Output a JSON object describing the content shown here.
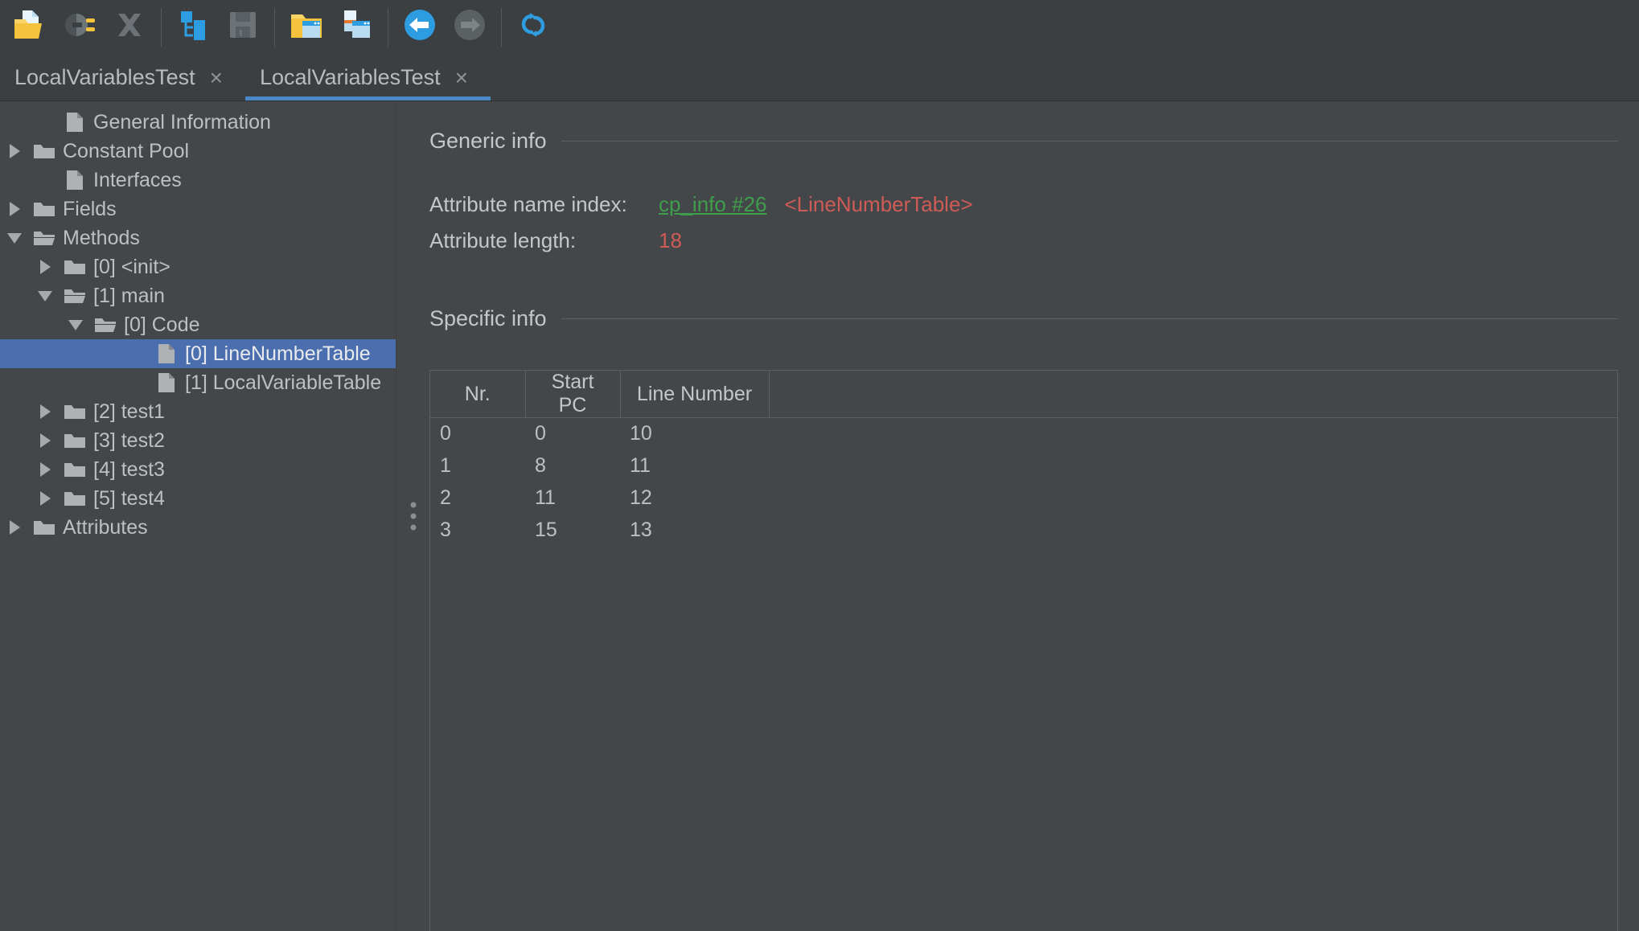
{
  "toolbar": {
    "buttons": [
      {
        "name": "open-class-file-icon",
        "title": "Open class file"
      },
      {
        "name": "browse-classpath-icon",
        "title": "Browse classpath"
      },
      {
        "name": "close-icon",
        "title": "Close"
      },
      {
        "name": "expand-tree-icon",
        "title": "Expand tree"
      },
      {
        "name": "save-icon",
        "title": "Save"
      },
      {
        "name": "open-window-icon",
        "title": "Open window"
      },
      {
        "name": "new-window-icon",
        "title": "New window"
      },
      {
        "name": "back-icon",
        "title": "Back"
      },
      {
        "name": "forward-icon",
        "title": "Forward"
      },
      {
        "name": "reload-icon",
        "title": "Reload"
      }
    ]
  },
  "tabs": [
    {
      "label": "LocalVariablesTest",
      "close": "×",
      "active": false
    },
    {
      "label": "LocalVariablesTest",
      "close": "×",
      "active": true
    }
  ],
  "tree": {
    "items": [
      {
        "label": "General Information",
        "indent": 1,
        "icon": "file",
        "toggle": "none",
        "selected": false
      },
      {
        "label": "Constant Pool",
        "indent": 0,
        "icon": "folder",
        "toggle": "closed",
        "selected": false
      },
      {
        "label": "Interfaces",
        "indent": 1,
        "icon": "file",
        "toggle": "none",
        "selected": false
      },
      {
        "label": "Fields",
        "indent": 0,
        "icon": "folder",
        "toggle": "closed",
        "selected": false
      },
      {
        "label": "Methods",
        "indent": 0,
        "icon": "folder-open",
        "toggle": "open",
        "selected": false
      },
      {
        "label": "[0] <init>",
        "indent": 1,
        "icon": "folder",
        "toggle": "closed",
        "selected": false
      },
      {
        "label": "[1] main",
        "indent": 1,
        "icon": "folder-open",
        "toggle": "open",
        "selected": false
      },
      {
        "label": "[0] Code",
        "indent": 2,
        "icon": "folder-open",
        "toggle": "open",
        "selected": false
      },
      {
        "label": "[0] LineNumberTable",
        "indent": 4,
        "icon": "file",
        "toggle": "none",
        "selected": true
      },
      {
        "label": "[1] LocalVariableTable",
        "indent": 4,
        "icon": "file",
        "toggle": "none",
        "selected": false
      },
      {
        "label": "[2] test1",
        "indent": 1,
        "icon": "folder",
        "toggle": "closed",
        "selected": false
      },
      {
        "label": "[3] test2",
        "indent": 1,
        "icon": "folder",
        "toggle": "closed",
        "selected": false
      },
      {
        "label": "[4] test3",
        "indent": 1,
        "icon": "folder",
        "toggle": "closed",
        "selected": false
      },
      {
        "label": "[5] test4",
        "indent": 1,
        "icon": "folder",
        "toggle": "closed",
        "selected": false
      },
      {
        "label": "Attributes",
        "indent": 0,
        "icon": "folder",
        "toggle": "closed",
        "selected": false
      }
    ]
  },
  "detail": {
    "generic_title": "Generic info",
    "specific_title": "Specific info",
    "attr_name_index_label": "Attribute name index:",
    "attr_name_index_link": "cp_info #26",
    "attr_name_index_value": "<LineNumberTable>",
    "attr_length_label": "Attribute length:",
    "attr_length_value": "18"
  },
  "table": {
    "columns": [
      "Nr.",
      "Start PC",
      "Line Number",
      ""
    ],
    "rows": [
      [
        "0",
        "0",
        "10"
      ],
      [
        "1",
        "8",
        "11"
      ],
      [
        "2",
        "11",
        "12"
      ],
      [
        "3",
        "15",
        "13"
      ]
    ]
  },
  "colors": {
    "background": "#43474a",
    "chrome": "#3c3f41",
    "selection": "#4b6eaf",
    "tab_accent": "#4a88c7",
    "link_green": "#3f9e4c",
    "value_red": "#cf5b56",
    "text": "#bcc0c2",
    "border": "#5c6063"
  }
}
